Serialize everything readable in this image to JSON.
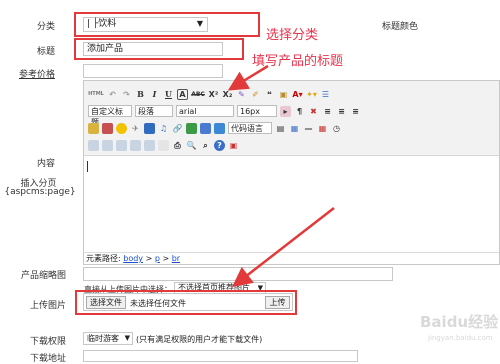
{
  "form": {
    "category_label": "分类",
    "category_value": "| ├饮料",
    "title_label": "标题",
    "title_value": "添加产品",
    "price_label": "参考价格",
    "content_label": "内容",
    "insert_page_label": "插入分页",
    "insert_page_tag": "{aspcms:page}",
    "thumb_label": "产品缩略图",
    "upload_label": "上传图片",
    "download_perm_label": "下载权限",
    "download_addr_label": "下载地址",
    "title_color_label": "标题颜色"
  },
  "editor": {
    "custom_title": "自定义标题",
    "paragraph": "段落",
    "font": "arial",
    "size": "16px",
    "code_lang": "代码语言",
    "path_label": "元素路径:",
    "path_items": [
      "body",
      "p",
      "br"
    ]
  },
  "thumb_row": {
    "hint": "直接从上传图片中选择：",
    "select": "不选择首页推荐图片"
  },
  "upload_row": {
    "choose_btn": "选择文件",
    "none_text": "未选择任何文件",
    "upload_btn": "上传"
  },
  "perm_row": {
    "select": "临时游客",
    "hint": "(只有满足权限的用户才能下载文件)"
  },
  "annotations": {
    "choose_category": "选择分类",
    "fill_title": "填写产品的标题"
  },
  "watermark": {
    "text": "Baidu经验",
    "sub": "jingyan.baidu.com"
  },
  "colors": {
    "annotation": "#e23a3a",
    "link": "#1a4fd0"
  }
}
